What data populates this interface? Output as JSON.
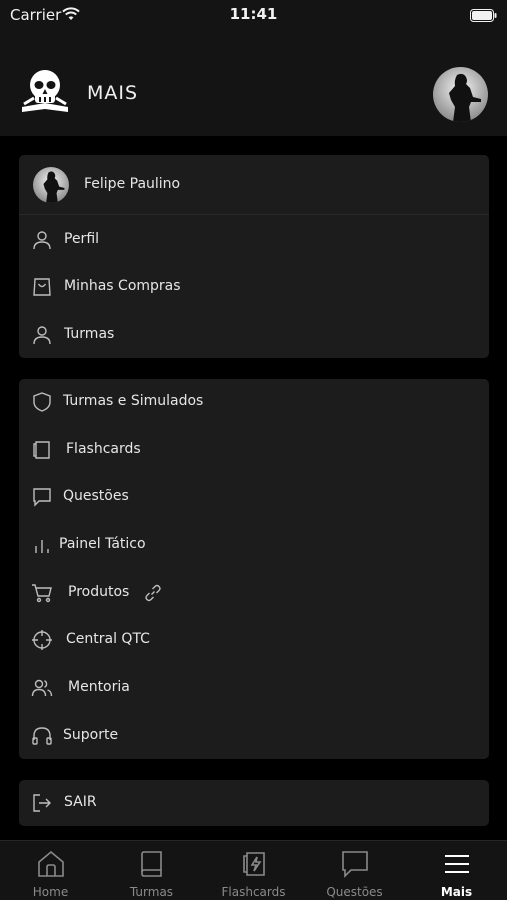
{
  "status_bar": {
    "carrier": "Carrier",
    "time": "11:41"
  },
  "header": {
    "title": "MAIS",
    "logo_icon": "skull-book-icon",
    "avatar_icon": "soldier-avatar-icon"
  },
  "account_card": {
    "user_name": "Felipe Paulino",
    "items": [
      {
        "label": "Perfil",
        "icon": "user-icon"
      },
      {
        "label": "Minhas Compras",
        "icon": "shopping-bag-icon"
      },
      {
        "label": "Turmas",
        "icon": "user-icon"
      }
    ]
  },
  "menu_card": {
    "items": [
      {
        "label": "Turmas e Simulados",
        "icon": "shield-icon"
      },
      {
        "label": "Flashcards",
        "icon": "flashcards-icon"
      },
      {
        "label": "Questões",
        "icon": "chat-bubble-icon"
      },
      {
        "label": "Painel Tático",
        "icon": "bar-chart-icon"
      },
      {
        "label": "Produtos",
        "icon": "cart-icon",
        "extra_icon": "link-icon"
      },
      {
        "label": "Central QTC",
        "icon": "crosshair-icon"
      },
      {
        "label": "Mentoria",
        "icon": "users-icon"
      },
      {
        "label": "Suporte",
        "icon": "headphones-icon"
      }
    ]
  },
  "logout": {
    "label": "SAIR",
    "icon": "logout-icon"
  },
  "tab_bar": {
    "active": "Mais",
    "tabs": [
      {
        "label": "Home",
        "icon": "home-icon"
      },
      {
        "label": "Turmas",
        "icon": "book-icon"
      },
      {
        "label": "Flashcards",
        "icon": "flashcards-lightning-icon"
      },
      {
        "label": "Questões",
        "icon": "chat-bubble-icon"
      },
      {
        "label": "Mais",
        "icon": "menu-icon"
      }
    ]
  },
  "colors": {
    "background": "#000000",
    "surface": "#1c1c1c",
    "header": "#141414",
    "text": "#e6e6e6",
    "inactive": "#8a8a8a"
  }
}
